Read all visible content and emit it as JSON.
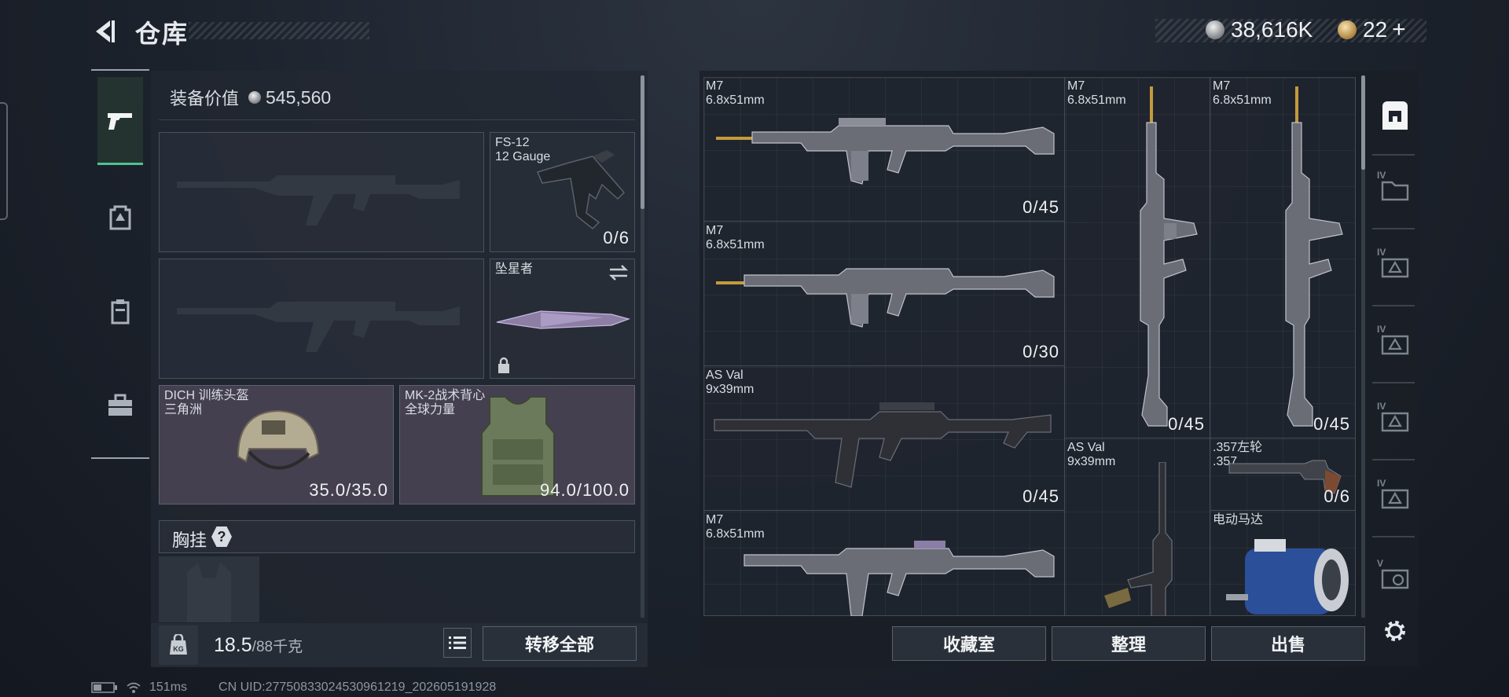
{
  "header": {
    "title": "仓库",
    "silver_amount": "38,616K",
    "gold_amount": "22",
    "gold_plus": "+"
  },
  "nav": {
    "items": [
      "weapons",
      "backpack-armor",
      "inventory-bag",
      "toolbox"
    ]
  },
  "loadout": {
    "value_label": "装备价值",
    "value": "545,560",
    "sidearm": {
      "name": "FS-12",
      "caliber": "12 Gauge",
      "count": "0/6"
    },
    "melee": {
      "name": "坠星者"
    },
    "helmet": {
      "name": "DICH 训练头盔",
      "sub": "三角洲",
      "durability": "35.0/35.0"
    },
    "armor": {
      "name": "MK-2战术背心",
      "sub": "全球力量",
      "durability": "94.0/100.0"
    },
    "chest_rig": {
      "label": "胸挂",
      "badge": "?"
    },
    "weight_current": "18.5",
    "weight_max": "/88千克",
    "transfer_all": "转移全部"
  },
  "storage": {
    "items": [
      {
        "name": "M7",
        "caliber": "6.8x51mm",
        "count": "0/45"
      },
      {
        "name": "M7",
        "caliber": "6.8x51mm",
        "count": "0/45"
      },
      {
        "name": "M7",
        "caliber": "6.8x51mm",
        "count": "0/45"
      },
      {
        "name": "M7",
        "caliber": "6.8x51mm",
        "count": "0/30"
      },
      {
        "name": "AS Val",
        "caliber": "9x39mm",
        "count": "0/45"
      },
      {
        "name": "AS Val",
        "caliber": "9x39mm",
        "count": ""
      },
      {
        "name": ".357左轮",
        "caliber": ".357",
        "count": "0/6"
      },
      {
        "name": "M7",
        "caliber": "6.8x51mm",
        "count": ""
      },
      {
        "name": "电动马达",
        "caliber": "",
        "count": ""
      }
    ],
    "buttons": {
      "collection": "收藏室",
      "sort": "整理",
      "sell": "出售"
    }
  },
  "side_tabs": [
    "main",
    "IV",
    "IV",
    "IV",
    "IV",
    "IV",
    "V"
  ],
  "status": {
    "ping": "151ms",
    "uid": "CN UID:27750833024530961219_202605191928"
  },
  "colors": {
    "accent_green": "#4ec48f",
    "panel": "#222832",
    "text": "#e6e9ee"
  }
}
